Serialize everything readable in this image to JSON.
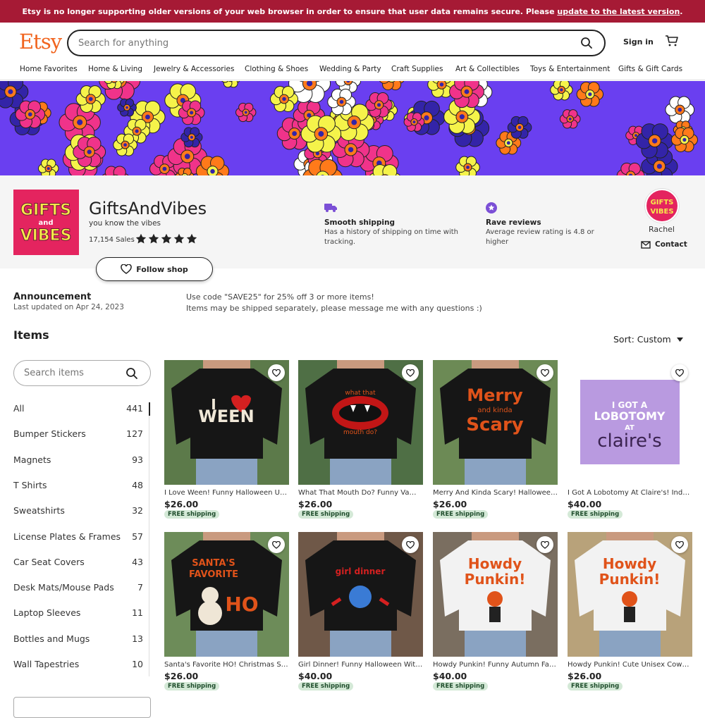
{
  "banner": {
    "text": "Etsy is no longer supporting older versions of your web browser in order to ensure that user data remains secure. Please ",
    "link": "update to the latest version",
    "end": "."
  },
  "header": {
    "logo": "Etsy",
    "search_placeholder": "Search for anything",
    "sign_in": "Sign in"
  },
  "nav": [
    "Home Favorites",
    "Home & Living",
    "Jewelry & Accessories",
    "Clothing & Shoes",
    "Wedding & Party",
    "Craft Supplies",
    "Art & Collectibles",
    "Toys & Entertainment",
    "Gifts & Gift Cards"
  ],
  "shop": {
    "logo_top": "GIFTS",
    "logo_mid": "and",
    "logo_bottom": "VIBES",
    "name": "GiftsAndVibes",
    "tagline": "you know the vibes",
    "sales": "17,154 Sales",
    "rating_stars": 5,
    "shipping_title": "Smooth shipping",
    "shipping_text": "Has a history of shipping on time with tracking.",
    "reviews_title": "Rave reviews",
    "reviews_text": "Average review rating is 4.8 or higher",
    "owner": "Rachel",
    "contact": "Contact",
    "follow": "Follow shop"
  },
  "announcement": {
    "title": "Announcement",
    "date": "Last updated on Apr 24, 2023",
    "line1": "Use code \"SAVE25\" for 25% off 3 or more items!",
    "line2": "Items may be shipped separately, please message me with any questions :)"
  },
  "items": {
    "title": "Items",
    "sort": "Sort: Custom",
    "search_placeholder": "Search items"
  },
  "categories": [
    {
      "name": "All",
      "count": "441"
    },
    {
      "name": "Bumper Stickers",
      "count": "127"
    },
    {
      "name": "Magnets",
      "count": "93"
    },
    {
      "name": "T Shirts",
      "count": "48"
    },
    {
      "name": "Sweatshirts",
      "count": "32"
    },
    {
      "name": "License Plates & Frames",
      "count": "57"
    },
    {
      "name": "Car Seat Covers",
      "count": "43"
    },
    {
      "name": "Desk Mats/Mouse Pads",
      "count": "7"
    },
    {
      "name": "Laptop Sleeves",
      "count": "11"
    },
    {
      "name": "Bottles and Mugs",
      "count": "13"
    },
    {
      "name": "Wall Tapestries",
      "count": "10"
    }
  ],
  "products": [
    {
      "title": "I Love Ween! Funny Halloween Unisex T-Shirt",
      "price": "$26.00",
      "shipping": "FREE shipping",
      "art_line1": "I",
      "art_line2": "WEEN"
    },
    {
      "title": "What That Mouth Do? Funny Vampire Halloween Shirt",
      "price": "$26.00",
      "shipping": "FREE shipping",
      "art_line1": "what that",
      "art_line2": "mouth do?"
    },
    {
      "title": "Merry And Kinda Scary! Halloween Christmas Sweatshirt",
      "price": "$26.00",
      "shipping": "FREE shipping",
      "art_line1": "Merry",
      "art_line2": "and kinda",
      "art_line3": "Scary"
    },
    {
      "title": "I Got A Lobotomy At Claire's! Indoor Wall Tapestry",
      "price": "$40.00",
      "shipping": "FREE shipping",
      "art_line1": "I GOT A",
      "art_line2": "LOBOTOMY",
      "art_line3": "AT",
      "art_line4": "claire's"
    },
    {
      "title": "Santa's Favorite HO! Christmas Snowman Shirt",
      "price": "$26.00",
      "shipping": "FREE shipping",
      "art_line1": "SANTA'S",
      "art_line2": "FAVORITE",
      "art_line3": "HO"
    },
    {
      "title": "Girl Dinner! Funny Halloween Witch Sweatshirt",
      "price": "$40.00",
      "shipping": "FREE shipping",
      "art_line1": "girl dinner"
    },
    {
      "title": "Howdy Punkin! Funny Autumn Fall Sweatshirt",
      "price": "$40.00",
      "shipping": "FREE shipping",
      "art_line1": "Howdy",
      "art_line2": "Punkin!"
    },
    {
      "title": "Howdy Punkin! Cute Unisex Cowboy Pumpkin Shirt",
      "price": "$26.00",
      "shipping": "FREE shipping",
      "art_line1": "Howdy",
      "art_line2": "Punkin!"
    }
  ],
  "colors": {
    "banner": "#a61a35",
    "brand": "#f1641e",
    "shop_logo": "#e4245f",
    "hero_bg": "#6a3ff0",
    "free_shipping_bg": "#d4e9d7",
    "shirt_orange": "#e0531a"
  },
  "icons": [
    "search-icon",
    "cart-icon",
    "truck-icon",
    "star-badge-icon",
    "mail-icon",
    "heart-icon",
    "chevron-down-icon"
  ]
}
